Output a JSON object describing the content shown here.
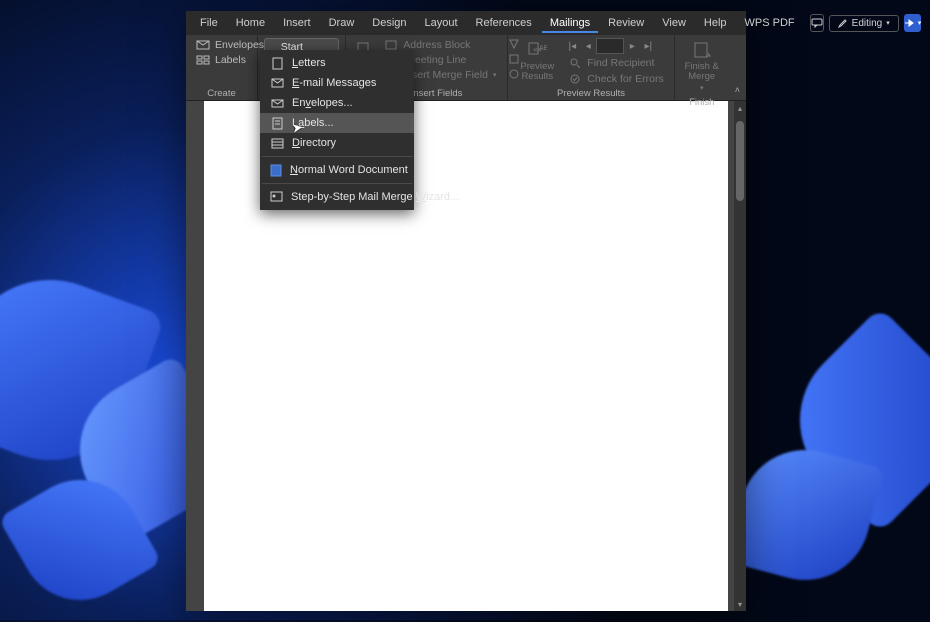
{
  "menubar": {
    "tabs": [
      "File",
      "Home",
      "Insert",
      "Draw",
      "Design",
      "Layout",
      "References",
      "Mailings",
      "Review",
      "View",
      "Help",
      "WPS PDF"
    ],
    "active_index": 7,
    "editing_label": "Editing"
  },
  "ribbon": {
    "create": {
      "label": "Create",
      "envelopes": "Envelopes",
      "labels": "Labels"
    },
    "start": {
      "button": "Start Mail Merge",
      "label": "te & Insert Fields",
      "address_block": "Address Block",
      "greeting_line": "Greeting Line",
      "insert_merge_field": "Insert Merge Field"
    },
    "preview": {
      "label": "Preview Results",
      "preview_results": "Preview\nResults",
      "find_recipient": "Find Recipient",
      "check_errors": "Check for Errors"
    },
    "finish": {
      "label": "Finish",
      "finish_merge": "Finish &\nMerge"
    }
  },
  "dropdown": {
    "items": [
      {
        "label": "Letters",
        "icon": "doc",
        "u": 0
      },
      {
        "label": "E-mail Messages",
        "icon": "mail",
        "u": 0
      },
      {
        "label": "Envelopes...",
        "icon": "envelope",
        "u": 2
      },
      {
        "label": "Labels...",
        "icon": "label",
        "u": 1
      },
      {
        "label": "Directory",
        "icon": "dir",
        "u": 0
      }
    ],
    "normal": "Normal Word Document",
    "wizard": "Step-by-Step Mail Merge Wizard..."
  }
}
